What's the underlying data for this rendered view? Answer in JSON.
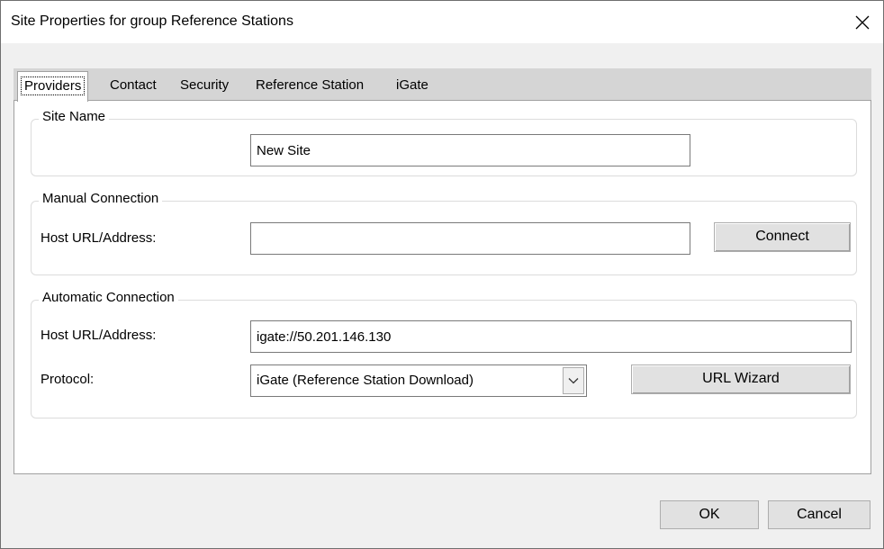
{
  "window": {
    "title": "Site Properties for group Reference Stations"
  },
  "tabs": [
    {
      "label": "Providers",
      "active": true
    },
    {
      "label": "Contact",
      "active": false
    },
    {
      "label": "Security",
      "active": false
    },
    {
      "label": "Reference Station",
      "active": false
    },
    {
      "label": "iGate",
      "active": false
    }
  ],
  "site_name": {
    "legend": "Site Name",
    "value": "New Site"
  },
  "manual_connection": {
    "legend": "Manual Connection",
    "host_label": "Host URL/Address:",
    "host_value": "",
    "connect_label": "Connect"
  },
  "automatic_connection": {
    "legend": "Automatic Connection",
    "host_label": "Host URL/Address:",
    "host_value": "igate://50.201.146.130",
    "protocol_label": "Protocol:",
    "protocol_value": "iGate (Reference Station Download)",
    "url_wizard_label": "URL Wizard"
  },
  "footer": {
    "ok_label": "OK",
    "cancel_label": "Cancel"
  },
  "icons": {
    "close": "close-icon",
    "dropdown": "chevron-down-icon"
  }
}
